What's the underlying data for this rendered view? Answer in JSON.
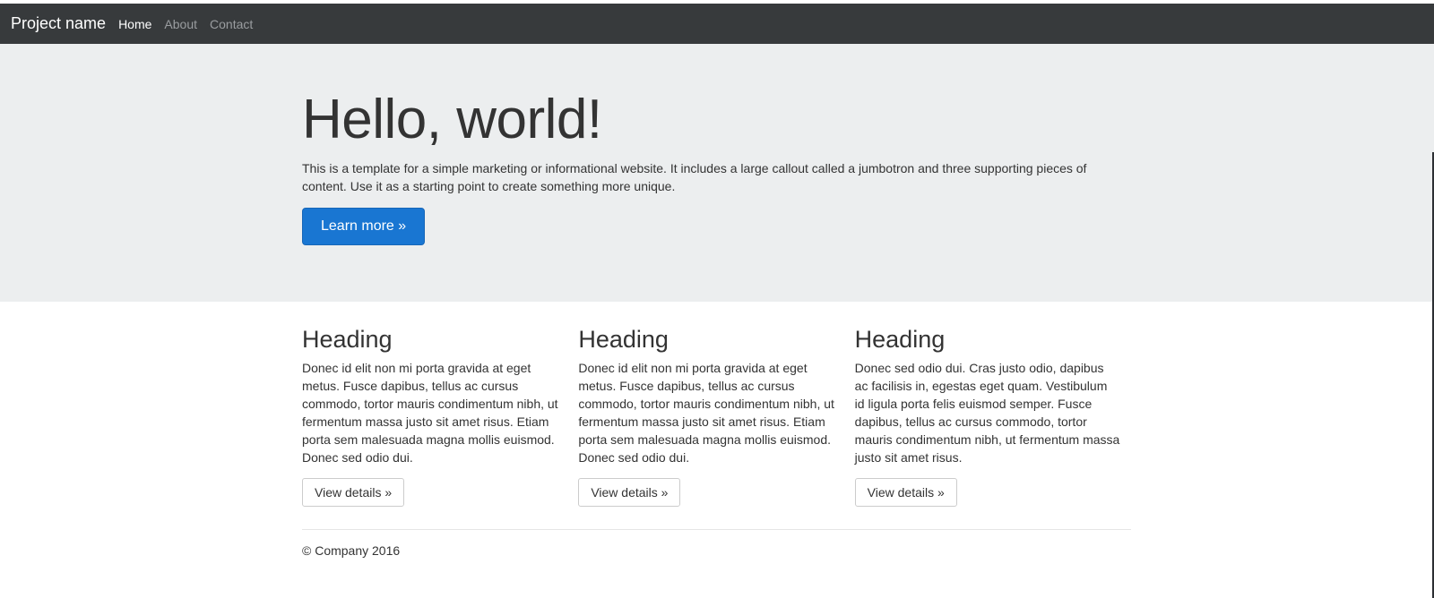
{
  "navbar": {
    "brand": "Project name",
    "links": [
      {
        "label": "Home",
        "active": true
      },
      {
        "label": "About",
        "active": false
      },
      {
        "label": "Contact",
        "active": false
      }
    ]
  },
  "jumbotron": {
    "title": "Hello, world!",
    "lead": "This is a template for a simple marketing or informational website. It includes a large callout called a jumbotron and three supporting pieces of content. Use it as a starting point to create something more unique.",
    "button_label": "Learn more »"
  },
  "columns": [
    {
      "heading": "Heading",
      "text": "Donec id elit non mi porta gravida at eget metus. Fusce dapibus, tellus ac cursus commodo, tortor mauris condimentum nibh, ut fermentum massa justo sit amet risus. Etiam porta sem malesuada magna mollis euismod. Donec sed odio dui.",
      "button_label": "View details »"
    },
    {
      "heading": "Heading",
      "text": "Donec id elit non mi porta gravida at eget metus. Fusce dapibus, tellus ac cursus commodo, tortor mauris condimentum nibh, ut fermentum massa justo sit amet risus. Etiam porta sem malesuada magna mollis euismod. Donec sed odio dui.",
      "button_label": "View details »"
    },
    {
      "heading": "Heading",
      "text": "Donec sed odio dui. Cras justo odio, dapibus ac facilisis in, egestas eget quam. Vestibulum id ligula porta felis euismod semper. Fusce dapibus, tellus ac cursus commodo, tortor mauris condimentum nibh, ut fermentum massa justo sit amet risus.",
      "button_label": "View details »"
    }
  ],
  "footer": {
    "text": "© Company 2016"
  },
  "colors": {
    "navbar_bg": "#373a3c",
    "jumbotron_bg": "#eceeef",
    "primary": "#1976d2"
  }
}
